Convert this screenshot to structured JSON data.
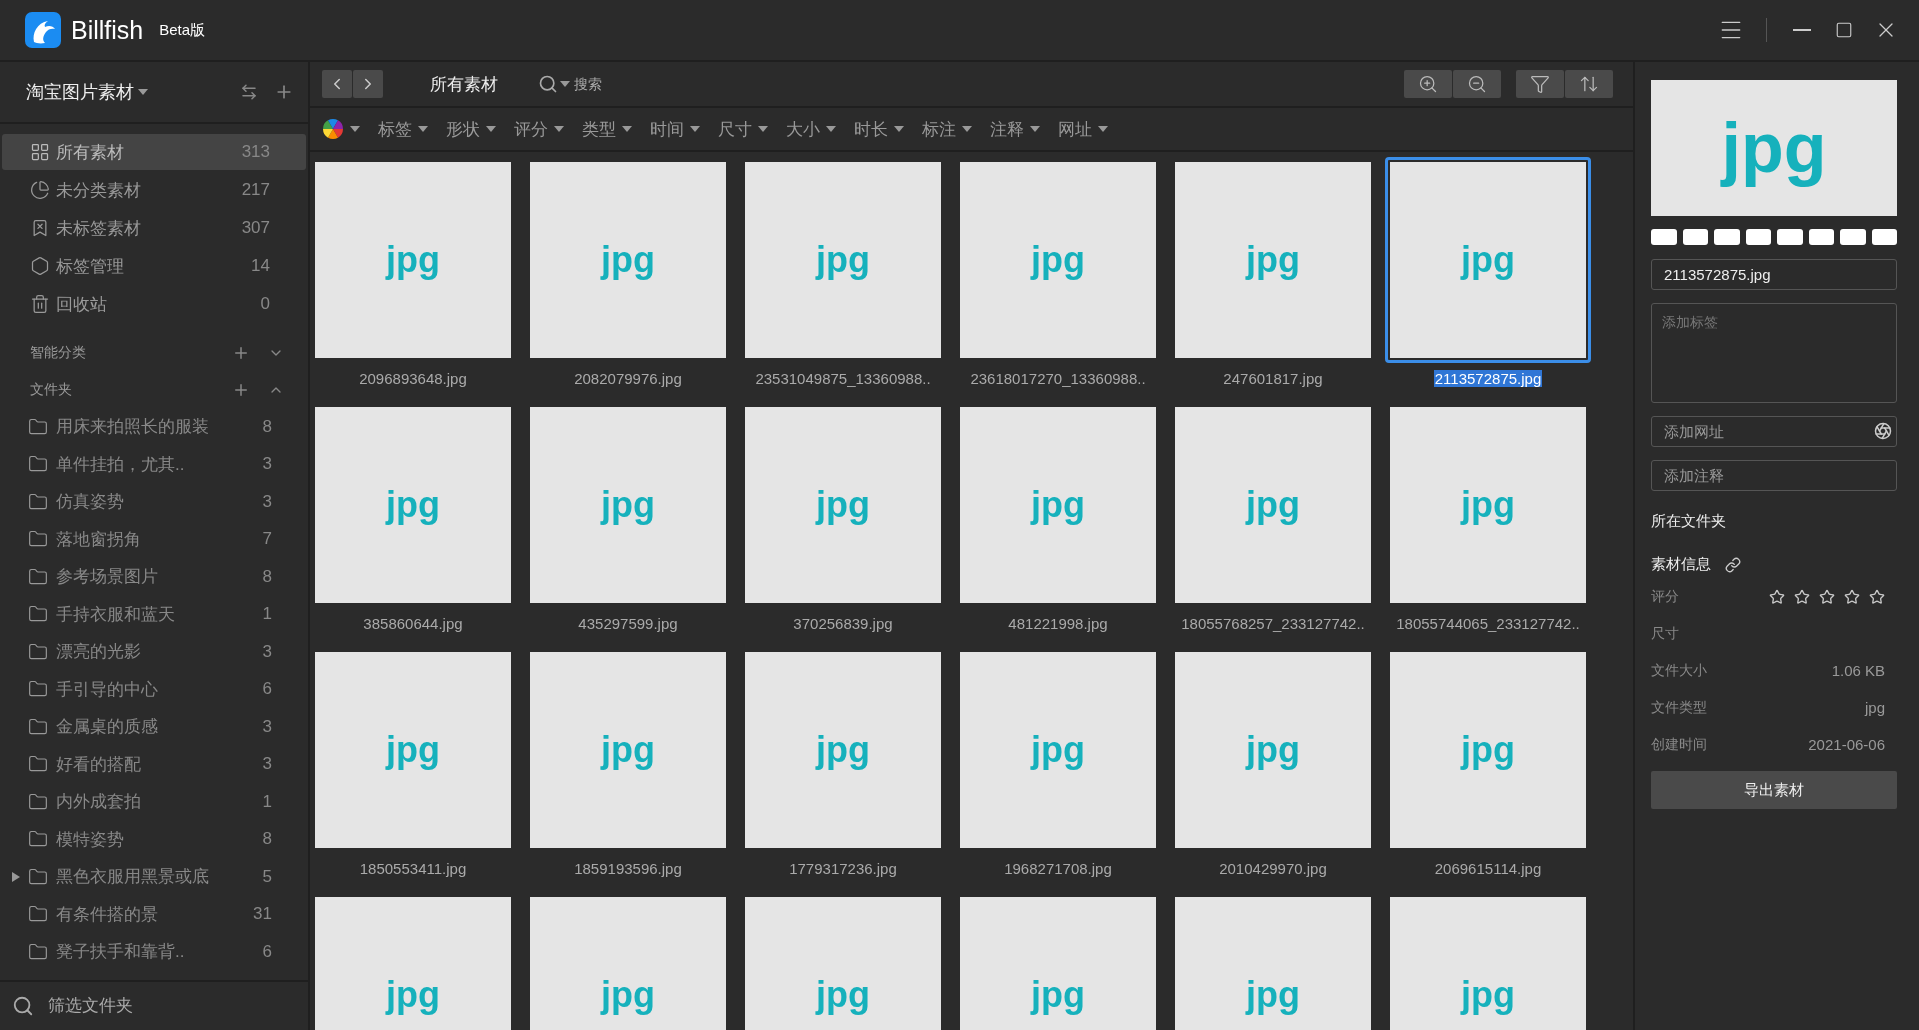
{
  "app": {
    "name": "Billfish",
    "edition": "Beta版"
  },
  "library": {
    "name": "淘宝图片素材"
  },
  "nav": [
    {
      "kind": "all",
      "label": "所有素材",
      "count": "313",
      "selected": true
    },
    {
      "kind": "unsorted",
      "label": "未分类素材",
      "count": "217",
      "selected": false
    },
    {
      "kind": "untagged",
      "label": "未标签素材",
      "count": "307",
      "selected": false
    },
    {
      "kind": "tags",
      "label": "标签管理",
      "count": "14",
      "selected": false
    },
    {
      "kind": "trash",
      "label": "回收站",
      "count": "0",
      "selected": false
    }
  ],
  "sections": [
    {
      "label": "智能分类",
      "expanded": false
    },
    {
      "label": "文件夹",
      "expanded": true
    }
  ],
  "folders": [
    {
      "label": "用床来拍照长的服装",
      "count": "8",
      "expandable": false
    },
    {
      "label": "单件挂拍，尤其..",
      "count": "3",
      "expandable": false
    },
    {
      "label": "仿真姿势",
      "count": "3",
      "expandable": false
    },
    {
      "label": "落地窗拐角",
      "count": "7",
      "expandable": false
    },
    {
      "label": "参考场景图片",
      "count": "8",
      "expandable": false
    },
    {
      "label": "手持衣服和蓝天",
      "count": "1",
      "expandable": false
    },
    {
      "label": "漂亮的光影",
      "count": "3",
      "expandable": false
    },
    {
      "label": "手引导的中心",
      "count": "6",
      "expandable": false
    },
    {
      "label": "金属桌的质感",
      "count": "3",
      "expandable": false
    },
    {
      "label": "好看的搭配",
      "count": "3",
      "expandable": false
    },
    {
      "label": "内外成套拍",
      "count": "1",
      "expandable": false
    },
    {
      "label": "模特姿势",
      "count": "8",
      "expandable": false
    },
    {
      "label": "黑色衣服用黑景或底",
      "count": "5",
      "expandable": true
    },
    {
      "label": "有条件搭的景",
      "count": "31",
      "expandable": false
    },
    {
      "label": "凳子扶手和靠背..",
      "count": "6",
      "expandable": false
    }
  ],
  "folder_filter": {
    "placeholder": "筛选文件夹"
  },
  "toolbar": {
    "title": "所有素材",
    "search_placeholder": "搜索"
  },
  "filters": [
    "标签",
    "形状",
    "评分",
    "类型",
    "时间",
    "尺寸",
    "大小",
    "时长",
    "标注",
    "注释",
    "网址"
  ],
  "tiles": [
    {
      "badge": "jpg",
      "name": "2096893648.jpg",
      "selected": false
    },
    {
      "badge": "jpg",
      "name": "2082079976.jpg",
      "selected": false
    },
    {
      "badge": "jpg",
      "name": "23531049875_13360988..",
      "selected": false
    },
    {
      "badge": "jpg",
      "name": "23618017270_13360988..",
      "selected": false
    },
    {
      "badge": "jpg",
      "name": "247601817.jpg",
      "selected": false
    },
    {
      "badge": "jpg",
      "name": "2113572875.jpg",
      "selected": true
    },
    {
      "badge": "jpg",
      "name": "385860644.jpg",
      "selected": false
    },
    {
      "badge": "jpg",
      "name": "435297599.jpg",
      "selected": false
    },
    {
      "badge": "jpg",
      "name": "370256839.jpg",
      "selected": false
    },
    {
      "badge": "jpg",
      "name": "481221998.jpg",
      "selected": false
    },
    {
      "badge": "jpg",
      "name": "18055768257_233127742..",
      "selected": false
    },
    {
      "badge": "jpg",
      "name": "18055744065_233127742..",
      "selected": false
    },
    {
      "badge": "jpg",
      "name": "1850553411.jpg",
      "selected": false
    },
    {
      "badge": "jpg",
      "name": "1859193596.jpg",
      "selected": false
    },
    {
      "badge": "jpg",
      "name": "1779317236.jpg",
      "selected": false
    },
    {
      "badge": "jpg",
      "name": "1968271708.jpg",
      "selected": false
    },
    {
      "badge": "jpg",
      "name": "2010429970.jpg",
      "selected": false
    },
    {
      "badge": "jpg",
      "name": "2069615114.jpg",
      "selected": false
    },
    {
      "badge": "jpg",
      "selected": false
    },
    {
      "badge": "jpg",
      "selected": false
    },
    {
      "badge": "jpg",
      "selected": false
    },
    {
      "badge": "jpg",
      "selected": false
    },
    {
      "badge": "jpg",
      "selected": false
    },
    {
      "badge": "jpg",
      "selected": false
    }
  ],
  "inspector": {
    "preview_badge": "jpg",
    "palette": [
      {
        "color": "#ffffff"
      },
      {
        "color": "#ffffff"
      },
      {
        "color": "#ffffff"
      },
      {
        "color": "#ffffff"
      },
      {
        "color": "#ffffff"
      },
      {
        "color": "#ffffff"
      },
      {
        "color": "#ffffff"
      },
      {
        "color": "#ffffff"
      }
    ],
    "filename": "2113572875.jpg",
    "tags_placeholder": "添加标签",
    "url_placeholder": "添加网址",
    "note_placeholder": "添加注释",
    "folder_heading": "所在文件夹",
    "info_heading": "素材信息",
    "rating": {
      "label": "评分",
      "stars": 0
    },
    "info": [
      {
        "label": "尺寸"
      },
      {
        "label": "文件大小",
        "value": "1.06 KB"
      },
      {
        "label": "文件类型",
        "value": "jpg"
      },
      {
        "label": "创建时间",
        "value": "2021-06-06"
      }
    ],
    "export_button": "导出素材"
  }
}
